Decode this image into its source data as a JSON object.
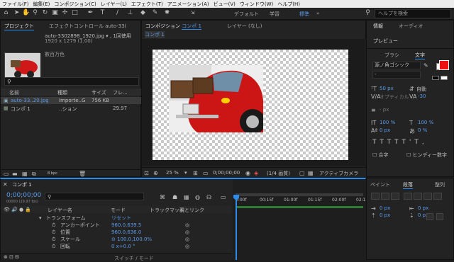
{
  "menu": [
    "ファイル(F)",
    "編集(E)",
    "コンポジション(C)",
    "レイヤー(L)",
    "エフェクト(T)",
    "アニメーション(A)",
    "ビュー(V)",
    "ウィンドウ(W)",
    "ヘルプ(H)"
  ],
  "workspaces": {
    "default": "デフォルト",
    "learn": "学習",
    "standard": "標準",
    "more": "»"
  },
  "search": {
    "placeholder": "ヘルプを検索"
  },
  "project": {
    "tab": "プロジェクト",
    "effect_tab": "エフェクトコントロール auto-33(",
    "item_name": "auto-3302898_1920.jpg ▾ , 1回使用",
    "item_info": "1920 x 1279 (1.00)",
    "item_extra": "數百万色",
    "columns": [
      "名前",
      "種類",
      "サイズ",
      "フレ..."
    ],
    "files": [
      {
        "name": "auto-33..20.jpg",
        "type": "Importe..G",
        "size": "756 KB",
        "frames": ""
      },
      {
        "name": "コンポ 1",
        "type": "..ション",
        "size": "",
        "frames": "29.97"
      }
    ],
    "bpc": "8 bpc"
  },
  "composition": {
    "tab": "コンポジション",
    "tab_comp": "コンポ 1",
    "layer_tab": "レイヤー (なし)",
    "sub_tab": "コンポ 1",
    "zoom": "25 %",
    "timecode": "0;00;00;00",
    "resolution": "(1/4 画質)",
    "camera": "アクティブカメラ"
  },
  "timeline": {
    "tab": "コンポ 1",
    "timecode": "0;00;00;00",
    "fps": "00000 (29.97 fps)",
    "columns": {
      "layer": "レイヤー名",
      "mode": "モード",
      "trkmat": "トラックマット",
      "parent": "親とリンク"
    },
    "rows": [
      {
        "indent": 1,
        "label": "トランスフォーム",
        "value": "リセット"
      },
      {
        "indent": 2,
        "label": "アンカーポイント",
        "value": "960.0,639.5"
      },
      {
        "indent": 2,
        "label": "位置",
        "value": "960.0,636.0"
      },
      {
        "indent": 2,
        "label": "スケール",
        "value": "⊖ 100.0,100.0%"
      },
      {
        "indent": 2,
        "label": "回転",
        "value": "0 x+0.0 °"
      }
    ],
    "switch_label": "スイッチ / モード",
    "ruler": [
      "0:00f",
      "00:15f",
      "01:00f",
      "01:15f",
      "02:00f",
      "02:1"
    ]
  },
  "info": {
    "tab_info": "情報",
    "tab_audio": "オーディオ",
    "tab_preview": "プレビュー",
    "tab_brush": "ブラシ",
    "tab_char": "文字",
    "font": "源ノ角ゴシック",
    "font_style": "-",
    "size": "50 px",
    "leading": "自動",
    "kerning": "オプティカル",
    "tracking": "-30",
    "vscale": "100 %",
    "hscale": "100 %",
    "baseline": "0 px",
    "tsume": "0 %",
    "unit": "- px",
    "faux": "合字",
    "hindi": "ヒンディー数字",
    "fill_color": "#ee1111"
  },
  "paragraph": {
    "tab_paint": "ペイント",
    "tab_para": "段落",
    "tab_more": "整列",
    "indent_left": "0 px",
    "indent_right": "0 px",
    "space_before": "0 px",
    "space_after": "0 px"
  }
}
